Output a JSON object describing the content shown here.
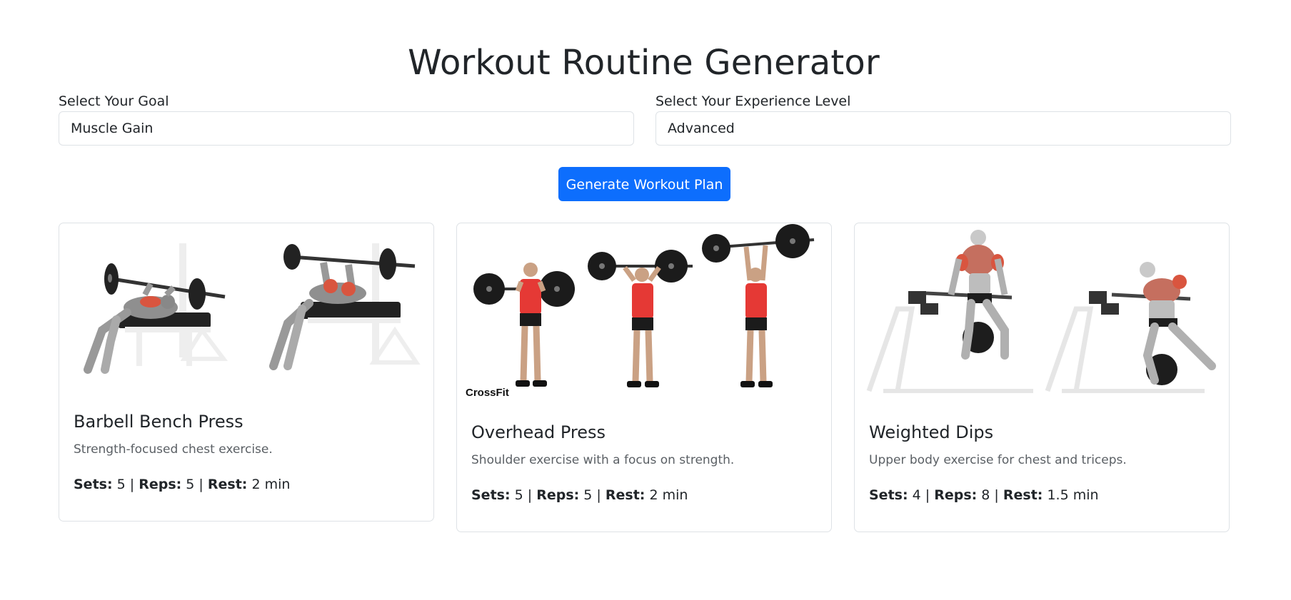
{
  "page_title": "Workout Routine Generator",
  "goal": {
    "label": "Select Your Goal",
    "value": "Muscle Gain"
  },
  "experience": {
    "label": "Select Your Experience Level",
    "value": "Advanced"
  },
  "generate_button": "Generate Workout Plan",
  "labels": {
    "sets": "Sets:",
    "reps": "Reps:",
    "rest": "Rest:",
    "sep": "|"
  },
  "exercises": [
    {
      "name": "Barbell Bench Press",
      "description": "Strength-focused chest exercise.",
      "sets": "5",
      "reps": "5",
      "rest": "2 min",
      "image": "bench-press-illustration"
    },
    {
      "name": "Overhead Press",
      "description": "Shoulder exercise with a focus on strength.",
      "sets": "5",
      "reps": "5",
      "rest": "2 min",
      "image": "overhead-press-illustration",
      "image_brand": "CrossFit"
    },
    {
      "name": "Weighted Dips",
      "description": "Upper body exercise for chest and triceps.",
      "sets": "4",
      "reps": "8",
      "rest": "1.5 min",
      "image": "weighted-dips-illustration"
    }
  ],
  "colors": {
    "accent": "#0d6efd",
    "text": "#212529",
    "muted": "#5a5f64",
    "border": "#dee2e6",
    "muscle": "#d9553f",
    "shirt": "#e53935"
  }
}
